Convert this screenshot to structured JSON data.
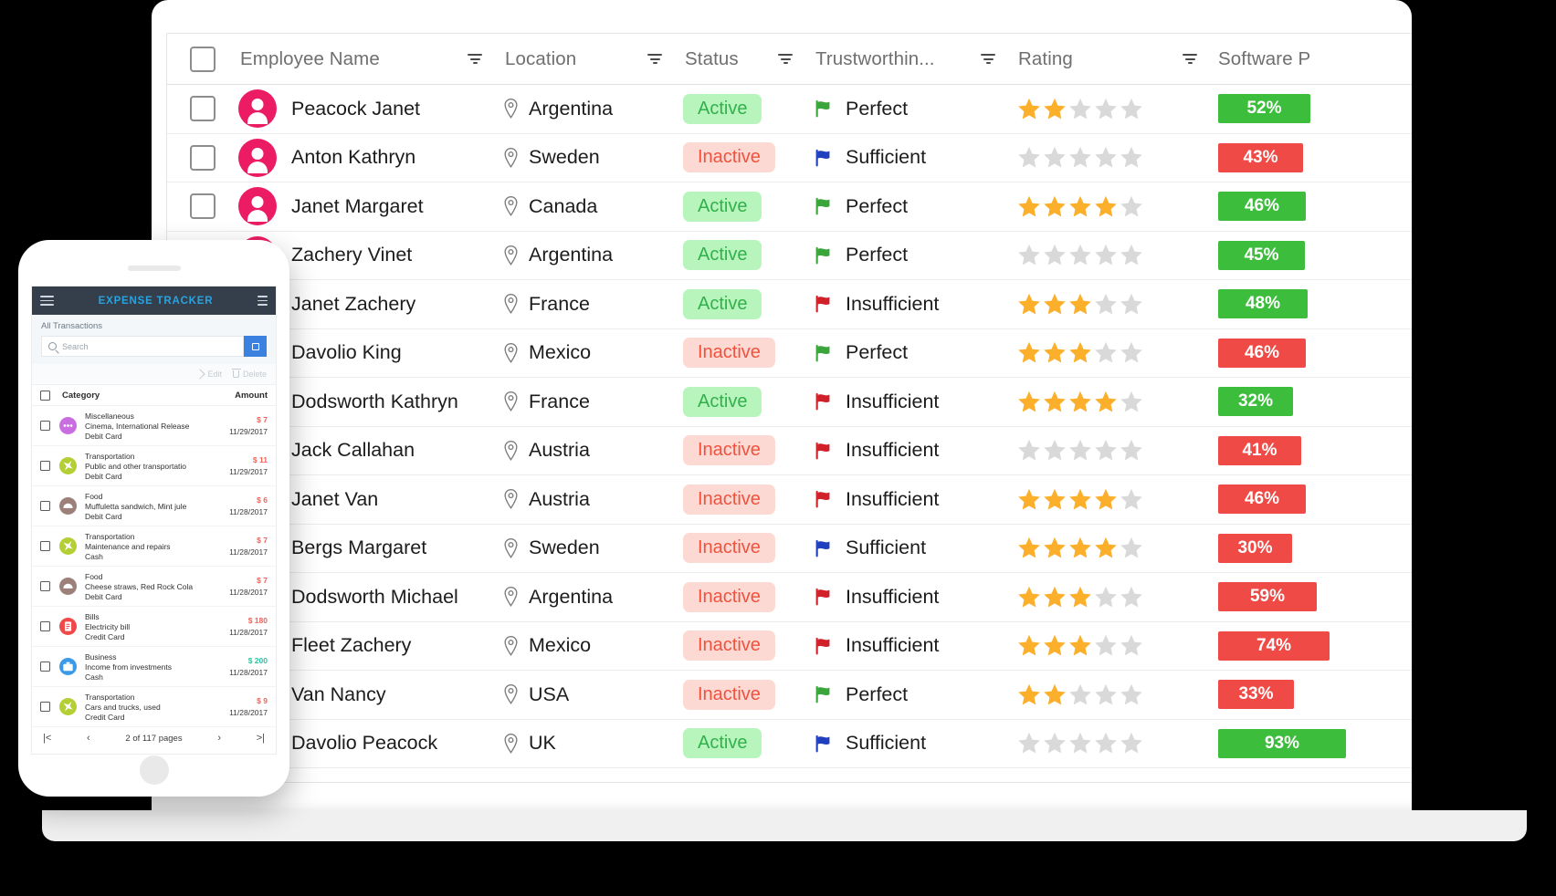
{
  "laptop": {
    "table": {
      "columns": [
        {
          "key": "check",
          "label": ""
        },
        {
          "key": "name",
          "label": "Employee Name"
        },
        {
          "key": "loc",
          "label": "Location"
        },
        {
          "key": "status",
          "label": "Status"
        },
        {
          "key": "trust",
          "label": "Trustworthin..."
        },
        {
          "key": "rating",
          "label": "Rating"
        },
        {
          "key": "soft",
          "label": "Software P"
        }
      ],
      "rows": [
        {
          "name": "Peacock Janet",
          "location": "Argentina",
          "status": "Active",
          "trust": "Perfect",
          "rating": 2,
          "pct": "52%",
          "pct_color": "green"
        },
        {
          "name": "Anton Kathryn",
          "location": "Sweden",
          "status": "Inactive",
          "trust": "Sufficient",
          "rating": 0,
          "pct": "43%",
          "pct_color": "red"
        },
        {
          "name": "Janet Margaret",
          "location": "Canada",
          "status": "Active",
          "trust": "Perfect",
          "rating": 4,
          "pct": "46%",
          "pct_color": "green"
        },
        {
          "name": "Zachery Vinet",
          "location": "Argentina",
          "status": "Active",
          "trust": "Perfect",
          "rating": 0,
          "pct": "45%",
          "pct_color": "green"
        },
        {
          "name": "Janet Zachery",
          "location": "France",
          "status": "Active",
          "trust": "Insufficient",
          "rating": 3,
          "pct": "48%",
          "pct_color": "green"
        },
        {
          "name": "Davolio King",
          "location": "Mexico",
          "status": "Inactive",
          "trust": "Perfect",
          "rating": 3,
          "pct": "46%",
          "pct_color": "red"
        },
        {
          "name": "Dodsworth Kathryn",
          "location": "France",
          "status": "Active",
          "trust": "Insufficient",
          "rating": 4,
          "pct": "32%",
          "pct_color": "green"
        },
        {
          "name": "Jack Callahan",
          "location": "Austria",
          "status": "Inactive",
          "trust": "Insufficient",
          "rating": 0,
          "pct": "41%",
          "pct_color": "red"
        },
        {
          "name": "Janet Van",
          "location": "Austria",
          "status": "Inactive",
          "trust": "Insufficient",
          "rating": 4,
          "pct": "46%",
          "pct_color": "red"
        },
        {
          "name": "Bergs Margaret",
          "location": "Sweden",
          "status": "Inactive",
          "trust": "Sufficient",
          "rating": 4,
          "pct": "30%",
          "pct_color": "red"
        },
        {
          "name": "Dodsworth Michael",
          "location": "Argentina",
          "status": "Inactive",
          "trust": "Insufficient",
          "rating": 3,
          "pct": "59%",
          "pct_color": "red"
        },
        {
          "name": "Fleet Zachery",
          "location": "Mexico",
          "status": "Inactive",
          "trust": "Insufficient",
          "rating": 3,
          "pct": "74%",
          "pct_color": "red"
        },
        {
          "name": "Van Nancy",
          "location": "USA",
          "status": "Inactive",
          "trust": "Perfect",
          "rating": 2,
          "pct": "33%",
          "pct_color": "red"
        },
        {
          "name": "Davolio Peacock",
          "location": "UK",
          "status": "Active",
          "trust": "Sufficient",
          "rating": 0,
          "pct": "93%",
          "pct_color": "green"
        }
      ]
    },
    "icons": {
      "filter": "filter-icon",
      "pin": "location-pin-icon",
      "flag": "flag-icon",
      "star": "star-icon",
      "avatar": "user-avatar-icon"
    }
  },
  "phone": {
    "app_title": "EXPENSE TRACKER",
    "menu_icon": "hamburger-menu-icon",
    "options_icon": "options-menu-icon",
    "subtitle": "All Transactions",
    "search_placeholder": "Search",
    "search_button_icon": "search-toggle-icon",
    "actions": {
      "edit": "Edit",
      "delete": "Delete"
    },
    "columns": {
      "category": "Category",
      "amount": "Amount"
    },
    "transactions": [
      {
        "category": "Miscellaneous",
        "description": "Cinema, International Release",
        "payment": "Debit Card",
        "amount": "$ 7",
        "sign": "neg",
        "date": "11/29/2017",
        "color": "#c96ee0",
        "icon": "dots-icon"
      },
      {
        "category": "Transportation",
        "description": "Public and other transportatio",
        "payment": "Debit Card",
        "amount": "$ 11",
        "sign": "neg",
        "date": "11/29/2017",
        "color": "#b4cf36",
        "icon": "plane-icon"
      },
      {
        "category": "Food",
        "description": "Muffuletta sandwich, Mint jule",
        "payment": "Debit Card",
        "amount": "$ 6",
        "sign": "neg",
        "date": "11/28/2017",
        "color": "#9c8079",
        "icon": "food-icon"
      },
      {
        "category": "Transportation",
        "description": "Maintenance and repairs",
        "payment": "Cash",
        "amount": "$ 7",
        "sign": "neg",
        "date": "11/28/2017",
        "color": "#b4cf36",
        "icon": "plane-icon"
      },
      {
        "category": "Food",
        "description": "Cheese straws, Red Rock Cola",
        "payment": "Debit Card",
        "amount": "$ 7",
        "sign": "neg",
        "date": "11/28/2017",
        "color": "#9c8079",
        "icon": "food-icon"
      },
      {
        "category": "Bills",
        "description": "Electricity bill",
        "payment": "Credit Card",
        "amount": "$ 180",
        "sign": "neg",
        "date": "11/28/2017",
        "color": "#f0494a",
        "icon": "bill-icon"
      },
      {
        "category": "Business",
        "description": "Income from investments",
        "payment": "Cash",
        "amount": "$ 200",
        "sign": "pos",
        "date": "11/28/2017",
        "color": "#3b9ae8",
        "icon": "briefcase-icon"
      },
      {
        "category": "Transportation",
        "description": "Cars and trucks, used",
        "payment": "Credit Card",
        "amount": "$ 9",
        "sign": "neg",
        "date": "11/28/2017",
        "color": "#b4cf36",
        "icon": "plane-icon"
      }
    ],
    "pager": {
      "first": "|<",
      "prev": "‹",
      "text": "2 of 117 pages",
      "next": "›",
      "last": ">|"
    }
  },
  "colors": {
    "accent_pink": "#ec1c64",
    "status_active_bg": "#b8f5bd",
    "status_active_fg": "#31b14b",
    "status_inactive_bg": "#fdd9d4",
    "status_inactive_fg": "#f0523e",
    "pct_green": "#3cbe3c",
    "pct_red": "#ef4a45",
    "star_on": "#fcaf2b",
    "star_off": "#d9d9d9",
    "flag_perfect": "#3aa53a",
    "flag_sufficient": "#2040c0",
    "flag_insufficient": "#d0212a",
    "phone_topbar": "#343f4b",
    "phone_title": "#29a3e0"
  }
}
